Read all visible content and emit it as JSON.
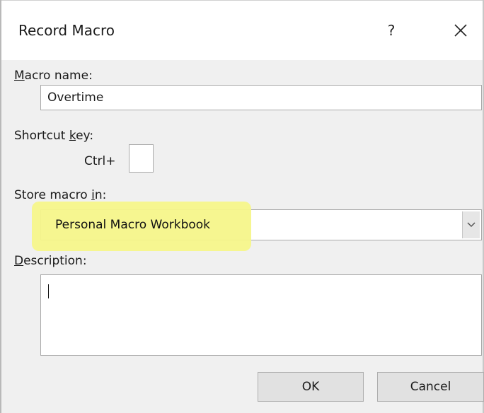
{
  "dialog": {
    "title": "Record Macro",
    "help_label": "?",
    "close_icon": "close-icon"
  },
  "macro_name": {
    "label_underlined": "M",
    "label_rest": "acro name:",
    "value": "Overtime"
  },
  "shortcut_key": {
    "label_before": "Shortcut ",
    "label_underlined": "k",
    "label_after": "ey:",
    "prefix": "Ctrl+",
    "value": ""
  },
  "store_macro_in": {
    "label_before": "Store macro ",
    "label_underlined": "i",
    "label_after": "n:",
    "selected": "Personal Macro Workbook",
    "highlight_color": "#f5f68a"
  },
  "description": {
    "label_underlined": "D",
    "label_rest": "escription:",
    "value": ""
  },
  "buttons": {
    "ok": "OK",
    "cancel": "Cancel"
  }
}
